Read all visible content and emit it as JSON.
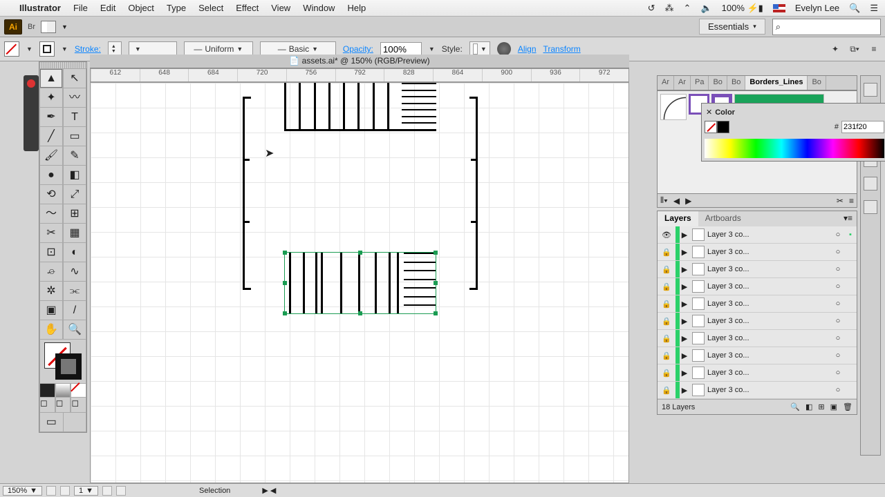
{
  "menubar": {
    "app": "Illustrator",
    "items": [
      "File",
      "Edit",
      "Object",
      "Type",
      "Select",
      "Effect",
      "View",
      "Window",
      "Help"
    ],
    "battery": "100%",
    "user": "Evelyn Lee"
  },
  "chrome": {
    "ai": "Ai",
    "br": "Br",
    "workspace": "Essentials",
    "search_icon": "⌕",
    "search_placeholder": ""
  },
  "control": {
    "stroke_label": "Stroke:",
    "stroke_weight": "",
    "uniform": "Uniform",
    "profile": "Basic",
    "opacity_label": "Opacity:",
    "opacity_value": "100%",
    "style_label": "Style:",
    "align": "Align",
    "transform": "Transform"
  },
  "document": {
    "title": "assets.ai* @ 150% (RGB/Preview)",
    "ruler_marks": [
      "612",
      "648",
      "684",
      "720",
      "756",
      "792",
      "828",
      "864",
      "900",
      "936",
      "972"
    ]
  },
  "panel_tabs": [
    "Ar",
    "Ar",
    "Pa",
    "Bo",
    "Bo",
    "Borders_Lines",
    "Bo"
  ],
  "color": {
    "title": "Color",
    "hex_label": "#",
    "hex_value": "231f20"
  },
  "layers": {
    "tab_layers": "Layers",
    "tab_artboards": "Artboards",
    "items": [
      {
        "name": "Layer 3 co...",
        "visible": true,
        "locked": false,
        "selected": true
      },
      {
        "name": "Layer 3 co...",
        "visible": false,
        "locked": true,
        "selected": false
      },
      {
        "name": "Layer 3 co...",
        "visible": false,
        "locked": true,
        "selected": false
      },
      {
        "name": "Layer 3 co...",
        "visible": false,
        "locked": true,
        "selected": false
      },
      {
        "name": "Layer 3 co...",
        "visible": false,
        "locked": true,
        "selected": false
      },
      {
        "name": "Layer 3 co...",
        "visible": false,
        "locked": true,
        "selected": false
      },
      {
        "name": "Layer 3 co...",
        "visible": false,
        "locked": true,
        "selected": false
      },
      {
        "name": "Layer 3 co...",
        "visible": false,
        "locked": true,
        "selected": false
      },
      {
        "name": "Layer 3 co...",
        "visible": false,
        "locked": true,
        "selected": false
      },
      {
        "name": "Layer 3 co...",
        "visible": false,
        "locked": true,
        "selected": false
      }
    ],
    "footer": "18 Layers"
  },
  "status": {
    "zoom": "150%",
    "artboard": "1",
    "tool": "Selection"
  },
  "tools": [
    [
      "selection",
      "direct-selection"
    ],
    [
      "magic-wand",
      "lasso"
    ],
    [
      "pen",
      "type"
    ],
    [
      "line",
      "rectangle"
    ],
    [
      "paintbrush",
      "pencil"
    ],
    [
      "blob",
      "eraser"
    ],
    [
      "rotate",
      "scale"
    ],
    [
      "width",
      "free-transform"
    ],
    [
      "shape-builder",
      "perspective"
    ],
    [
      "mesh",
      "gradient"
    ],
    [
      "eyedropper",
      "blend"
    ],
    [
      "symbol-spray",
      "graph"
    ],
    [
      "artboard",
      "slice"
    ],
    [
      "hand",
      "zoom"
    ]
  ],
  "tool_glyphs": [
    [
      "▲",
      "↖"
    ],
    [
      "✦",
      "〰"
    ],
    [
      "✒",
      "T"
    ],
    [
      "╱",
      "▭"
    ],
    [
      "🖌",
      "✎"
    ],
    [
      "●",
      "◧"
    ],
    [
      "⟲",
      "⤢"
    ],
    [
      "〜",
      "⊞"
    ],
    [
      "✂",
      "▦"
    ],
    [
      "⊡",
      "◐"
    ],
    [
      "⌮",
      "∿"
    ],
    [
      "✲",
      "⫘"
    ],
    [
      "▣",
      "/"
    ],
    [
      "✋",
      "🔍"
    ]
  ]
}
